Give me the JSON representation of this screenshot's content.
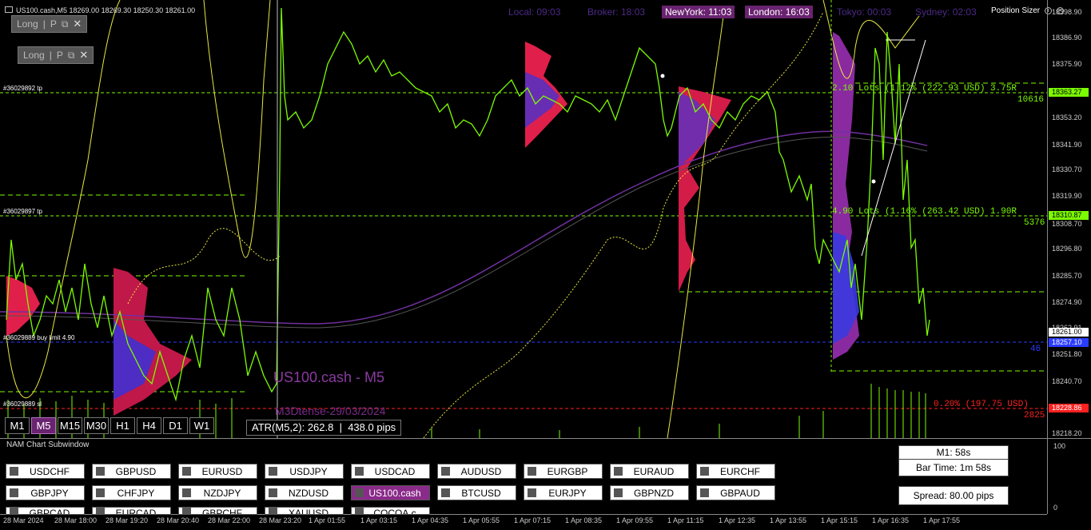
{
  "header": {
    "symbol_info": "US100.cash,M5  18269.00 18269.30 18250.30 18261.00",
    "panels": [
      {
        "label": "Long",
        "sep": "|",
        "suffix": "P"
      },
      {
        "label": "Long",
        "sep": "|",
        "suffix": "P"
      }
    ]
  },
  "sessions": [
    {
      "label": "Local: 09:03",
      "active": false
    },
    {
      "label": "Broker: 18:03",
      "active": false
    },
    {
      "label": "NewYork: 11:03",
      "active": true
    },
    {
      "label": "London: 16:03",
      "active": true
    },
    {
      "label": "Tokyo: 00:03",
      "active": false
    },
    {
      "label": "Sydney: 02:03",
      "active": false
    }
  ],
  "position_sizer": "Position Sizer",
  "price_axis": {
    "labels": [
      "18398.90",
      "18386.90",
      "18375.90",
      "18364.27",
      "18353.20",
      "18341.90",
      "18330.70",
      "18319.90",
      "18308.70",
      "18296.80",
      "18285.70",
      "18274.90",
      "18262.91",
      "18251.80",
      "18240.70",
      "18229.70",
      "18218.20"
    ],
    "tags": [
      {
        "text": "18363.27",
        "color": "#7cfc00"
      },
      {
        "text": "18310.87",
        "color": "#7cfc00"
      },
      {
        "text": "18261.00",
        "color": "#ffffff"
      },
      {
        "text": "18257.10",
        "color": "#2a3cff"
      },
      {
        "text": "18228.86",
        "color": "#ff2020"
      }
    ]
  },
  "lines": {
    "tp1_label": "#36029892 tp",
    "tp2_label": "#36029897 tp",
    "buy_label": "#36029889 buy limit 4.90",
    "sl_label": "#36029889 sl",
    "tp1_lots": "2.10 Lots (1.12% (222.93 USD) 3.75R",
    "tp1_pips": "10616",
    "tp2_lots": "4.90 Lots (1.16% (263.42 USD) 1.90R",
    "tp2_pips": "5376",
    "entry_pips": "46",
    "sl_lots": "0.20% (197.75 USD)",
    "sl_pips": "2825"
  },
  "timeframes": {
    "items": [
      "M1",
      "M5",
      "M15",
      "M30",
      "H1",
      "H4",
      "D1",
      "W1"
    ],
    "active": "M5"
  },
  "atr": {
    "label": "ATR(M5,2): 262.8",
    "pips": "438.0 pips"
  },
  "watermark": {
    "symbol": "US100.cash - M5",
    "date": "M3Dtense-29/03/2024"
  },
  "time_axis": [
    "28 Mar 2024",
    "28 Mar 18:00",
    "28 Mar 19:20",
    "28 Mar 20:40",
    "28 Mar 22:00",
    "28 Mar 23:20",
    "1 Apr 01:55",
    "1 Apr 03:15",
    "1 Apr 04:35",
    "1 Apr 05:55",
    "1 Apr 07:15",
    "1 Apr 08:35",
    "1 Apr 09:55",
    "1 Apr 11:15",
    "1 Apr 12:35",
    "1 Apr 13:55",
    "1 Apr 15:15",
    "1 Apr 16:35",
    "1 Apr 17:55"
  ],
  "subwindow": {
    "title": "NAM Chart Subwindow",
    "row1": [
      "USDCHF",
      "GBPUSD",
      "EURUSD",
      "USDJPY",
      "USDCAD",
      "AUDUSD",
      "EURGBP",
      "EURAUD",
      "EURCHF"
    ],
    "row2": [
      "GBPJPY",
      "CHFJPY",
      "NZDJPY",
      "NZDUSD",
      "US100.cash",
      "BTCUSD",
      "EURJPY",
      "GBPNZD",
      "GBPAUD"
    ],
    "row3": [
      "GBPCAD",
      "EURCAD",
      "GBPCHF",
      "XAUUSD",
      "COCOA.c"
    ],
    "active": "US100.cash",
    "m1_timer": "M1:  58s",
    "bar_time": "Bar Time: 1m 58s",
    "spread": "Spread: 80.00 pips",
    "axis_labels": [
      "100",
      "0"
    ]
  },
  "colors": {
    "price_line": "#7cfc00",
    "accent": "#6a2370",
    "tp": "#7cfc00",
    "sl": "#ff2020",
    "entry": "#2a3cff",
    "ma": "#ffff40"
  }
}
